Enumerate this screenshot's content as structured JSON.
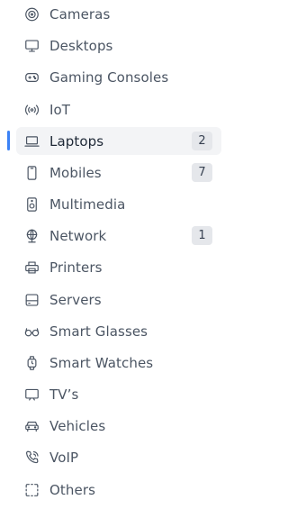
{
  "sidebar": {
    "active_index": 4,
    "colors": {
      "accent": "#3b82f6",
      "active_bg": "#f3f4f6",
      "badge_bg": "#e5e7eb",
      "text": "#4b5563"
    },
    "items": [
      {
        "label": "Cameras",
        "icon": "camera-icon"
      },
      {
        "label": "Desktops",
        "icon": "desktop-icon"
      },
      {
        "label": "Gaming Consoles",
        "icon": "gamepad-icon"
      },
      {
        "label": "IoT",
        "icon": "iot-signal-icon"
      },
      {
        "label": "Laptops",
        "icon": "laptop-icon",
        "badge": "2"
      },
      {
        "label": "Mobiles",
        "icon": "mobile-icon",
        "badge": "7"
      },
      {
        "label": "Multimedia",
        "icon": "speaker-icon"
      },
      {
        "label": "Network",
        "icon": "network-globe-icon",
        "badge": "1"
      },
      {
        "label": "Printers",
        "icon": "printer-icon"
      },
      {
        "label": "Servers",
        "icon": "server-icon"
      },
      {
        "label": "Smart Glasses",
        "icon": "glasses-icon"
      },
      {
        "label": "Smart Watches",
        "icon": "watch-icon"
      },
      {
        "label": "TV’s",
        "icon": "tv-icon"
      },
      {
        "label": "Vehicles",
        "icon": "car-icon"
      },
      {
        "label": "VoIP",
        "icon": "phone-icon"
      },
      {
        "label": "Others",
        "icon": "others-dashed-icon"
      }
    ]
  }
}
